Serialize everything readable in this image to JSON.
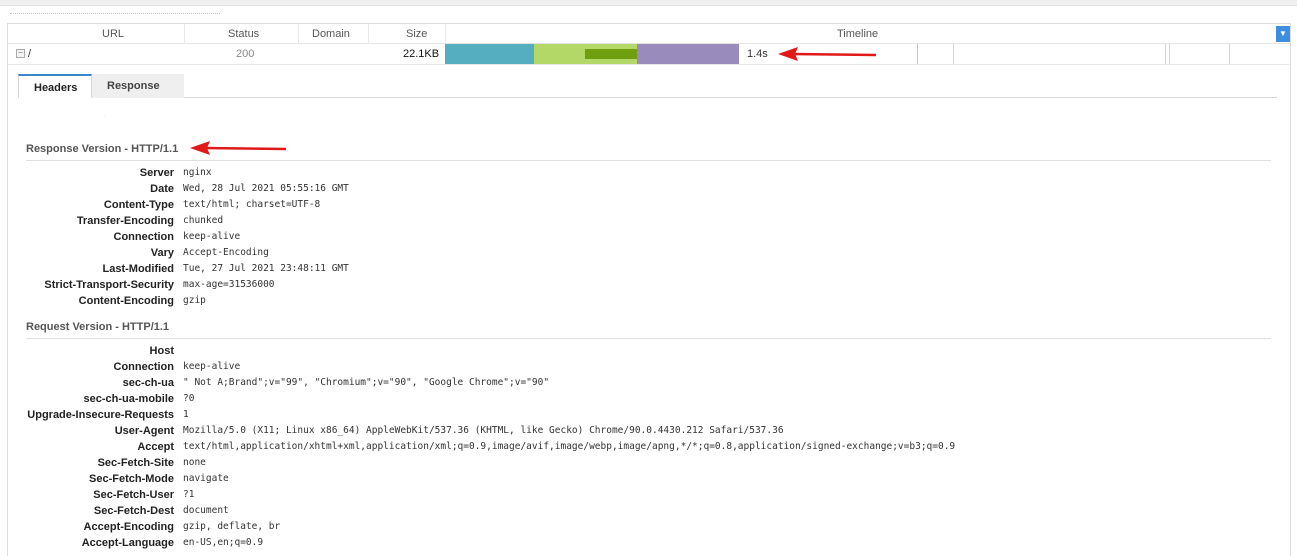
{
  "columns": {
    "url": "URL",
    "status": "Status",
    "domain": "Domain",
    "size": "Size",
    "timeline": "Timeline"
  },
  "request": {
    "url": "/",
    "status": "200",
    "domain": "",
    "size": "22.1KB",
    "time": "1.4s"
  },
  "tabs": {
    "headers": "Headers",
    "response": "Response"
  },
  "response_section": {
    "title": "Response Version - HTTP/1.1",
    "headers": [
      {
        "name": "Server",
        "value": "nginx"
      },
      {
        "name": "Date",
        "value": "Wed, 28 Jul 2021 05:55:16 GMT"
      },
      {
        "name": "Content-Type",
        "value": "text/html; charset=UTF-8"
      },
      {
        "name": "Transfer-Encoding",
        "value": "chunked"
      },
      {
        "name": "Connection",
        "value": "keep-alive"
      },
      {
        "name": "Vary",
        "value": "Accept-Encoding"
      },
      {
        "name": "Last-Modified",
        "value": "Tue, 27 Jul 2021 23:48:11 GMT"
      },
      {
        "name": "Strict-Transport-Security",
        "value": "max-age=31536000"
      },
      {
        "name": "Content-Encoding",
        "value": "gzip"
      }
    ]
  },
  "request_section": {
    "title": "Request Version - HTTP/1.1",
    "headers": [
      {
        "name": "Host",
        "value": ""
      },
      {
        "name": "Connection",
        "value": "keep-alive"
      },
      {
        "name": "sec-ch-ua",
        "value": "\" Not A;Brand\";v=\"99\", \"Chromium\";v=\"90\", \"Google Chrome\";v=\"90\""
      },
      {
        "name": "sec-ch-ua-mobile",
        "value": "?0"
      },
      {
        "name": "Upgrade-Insecure-Requests",
        "value": "1"
      },
      {
        "name": "User-Agent",
        "value": "Mozilla/5.0 (X11; Linux x86_64) AppleWebKit/537.36 (KHTML, like Gecko) Chrome/90.0.4430.212 Safari/537.36"
      },
      {
        "name": "Accept",
        "value": "text/html,application/xhtml+xml,application/xml;q=0.9,image/avif,image/webp,image/apng,*/*;q=0.8,application/signed-exchange;v=b3;q=0.9"
      },
      {
        "name": "Sec-Fetch-Site",
        "value": "none"
      },
      {
        "name": "Sec-Fetch-Mode",
        "value": "navigate"
      },
      {
        "name": "Sec-Fetch-User",
        "value": "?1"
      },
      {
        "name": "Sec-Fetch-Dest",
        "value": "document"
      },
      {
        "name": "Accept-Encoding",
        "value": "gzip, deflate, br"
      },
      {
        "name": "Accept-Language",
        "value": "en-US,en;q=0.9"
      }
    ]
  },
  "colors": {
    "timeline_blocking": "#54aebf",
    "timeline_waiting": "#b3d867",
    "timeline_waiting_inner": "#6f9e0f",
    "timeline_receiving": "#9a8bbd",
    "annotation_arrow": "#e11919",
    "tab_accent": "#3a87c9",
    "dropdown": "#3e8ee0"
  },
  "icons": {
    "collapse": "minus-box-icon",
    "dropdown": "chevron-down-icon",
    "annotation": "red-arrow"
  }
}
